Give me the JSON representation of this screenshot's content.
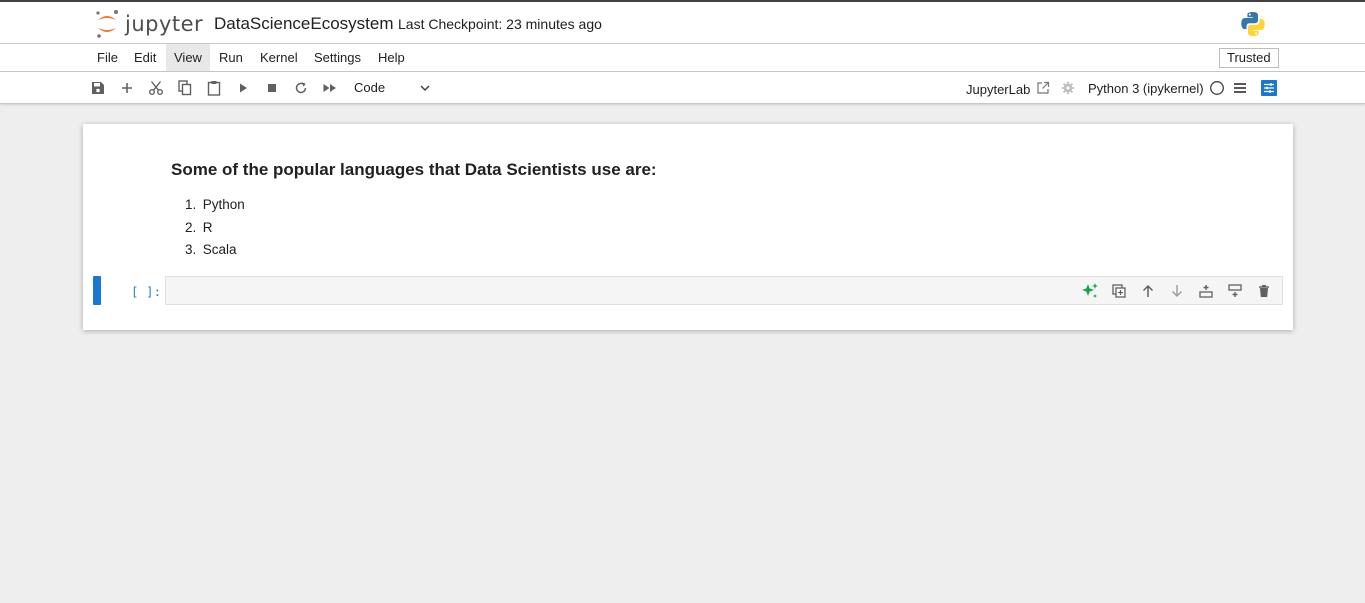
{
  "header": {
    "logo_text": "jupyter",
    "notebook_title": "DataScienceEcosystem",
    "checkpoint": "Last Checkpoint: 23 minutes ago",
    "kernel_logo": "python-logo-icon"
  },
  "menubar": {
    "items": [
      "File",
      "Edit",
      "View",
      "Run",
      "Kernel",
      "Settings",
      "Help"
    ],
    "active": "View",
    "trusted": "Trusted"
  },
  "toolbar": {
    "icons": [
      "save-icon",
      "add-icon",
      "cut-icon",
      "copy-icon",
      "paste-icon",
      "run-icon",
      "stop-icon",
      "restart-icon",
      "fast-forward-icon"
    ],
    "cell_type": "Code",
    "jupyterlab_label": "JupyterLab",
    "kernel_name": "Python 3 (ipykernel)"
  },
  "notebook": {
    "markdown_cell": {
      "heading": "Some of the popular languages that Data Scientists use are:",
      "items": [
        {
          "num": "1.",
          "text": "Python"
        },
        {
          "num": "2.",
          "text": "R"
        },
        {
          "num": "3.",
          "text": "Scala"
        }
      ]
    },
    "code_cell": {
      "prompt": "[ ]:",
      "value": "",
      "tools": [
        "sparkle-icon",
        "duplicate-icon",
        "move-up-icon",
        "move-down-icon",
        "insert-above-icon",
        "insert-below-icon",
        "delete-icon"
      ]
    }
  },
  "colors": {
    "accent": "#1976d2",
    "prompt": "#307fc1",
    "jupyter_orange": "#f37626",
    "sparkle_green": "#16a34a"
  }
}
